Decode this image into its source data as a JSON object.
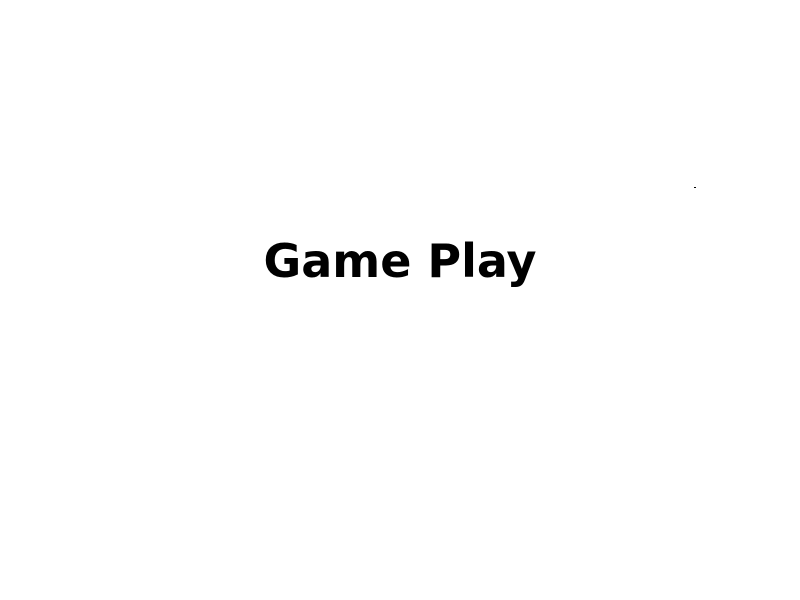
{
  "screen": {
    "title": "Game Play",
    "background_color": "#ffffff",
    "text_color": "#000000"
  }
}
